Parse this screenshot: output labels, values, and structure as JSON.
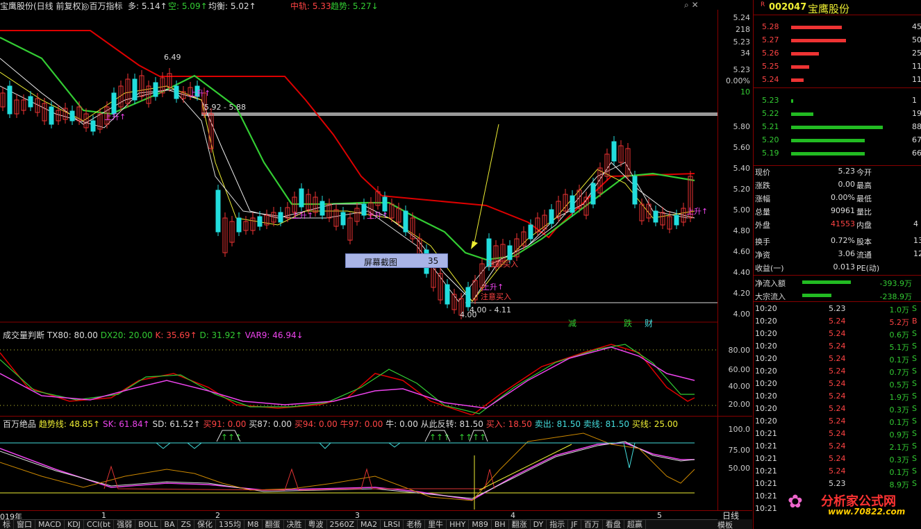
{
  "header": {
    "stock": "宝鹰股份(日线 前复权)",
    "indicator": "百万指标",
    "duo": "多: 5.14↑",
    "kong": "空: 5.09↑",
    "jun": "均衡: 5.02↑",
    "zhonggui": "中轨: 5.33",
    "qushi": "趋势: 5.27↓"
  },
  "main_axis": [
    "5.24",
    "218",
    "5.23",
    "34",
    "5.23",
    "0.00%",
    "10",
    "5.80",
    "5.60",
    "5.40",
    "5.20",
    "5.00",
    "4.80",
    "4.60",
    "4.40",
    "4.20",
    "4.00"
  ],
  "annotations": {
    "high": "6.49",
    "gap": "5.92 - 5.88",
    "low": "4.00 - 4.11",
    "low2": "4.00",
    "buy": "注意买入",
    "up1": "上升↑",
    "up2": "上升↑",
    "up3": "上升↑",
    "up4": "上升↑",
    "up5": "上升↑",
    "jian": "减",
    "die": "跌",
    "cai": "财"
  },
  "tooltip": {
    "label": "屏幕截图",
    "value": "35"
  },
  "vol_header": {
    "name": "成交量判断",
    "tx80": "TX80: 80.00",
    "dx20": "DX20: 20.00",
    "k": "K: 35.69↑",
    "d": "D: 31.92↑",
    "var9": "VAR9: 46.94↓"
  },
  "vol_axis": [
    "80.00",
    "60.00",
    "40.00",
    "20.00"
  ],
  "bw_header": {
    "name": "百万绝品",
    "qsx": "趋势线: 48.85↑",
    "sk": "SK: 61.84↑",
    "sd": "SD: 61.52↑",
    "m91": "买91: 0.00",
    "m87": "买87: 0.00",
    "m94": "买94: 0.00",
    "n97": "牛97: 0.00",
    "niu": "牛: 0.00",
    "cc": "从此反转: 81.50",
    "mr": "买入: 18.50",
    "mc": "卖出: 81.50",
    "mx": "卖线: 81.50",
    "mxb": "买线: 25.00"
  },
  "bw_axis": [
    "100.0",
    "75.00",
    "50.00"
  ],
  "date_axis": [
    "019年",
    "1",
    "2",
    "3",
    "4",
    "5"
  ],
  "tabs": [
    "标",
    "窗口",
    "MACD",
    "KDJ",
    "CCI(bt",
    "强弱",
    "BOLL",
    "BA",
    "ZS",
    "保化",
    "135均",
    "M8",
    "翻蛋",
    "决胜",
    "粤波",
    "2560Z",
    "MA2",
    "LRSI",
    "老杨",
    "里牛",
    "HHY",
    "M89",
    "BH",
    "翻涨",
    "DY",
    "指示",
    "JF",
    "百万",
    "看盘",
    "超赢"
  ],
  "bottom_right": {
    "model": "模板",
    "period": "日线"
  },
  "quote": {
    "code": "002047",
    "name": "宝鹰股份",
    "flag": "R",
    "asks": [
      {
        "p": "5.28",
        "v": "45",
        "w": 0.55
      },
      {
        "p": "5.27",
        "v": "50",
        "w": 0.6
      },
      {
        "p": "5.26",
        "v": "25",
        "w": 0.3
      },
      {
        "p": "5.25",
        "v": "11",
        "w": 0.2
      },
      {
        "p": "5.24",
        "v": "11",
        "w": 0.14
      }
    ],
    "bids": [
      {
        "p": "5.23",
        "v": "1",
        "w": 0.02
      },
      {
        "p": "5.22",
        "v": "19",
        "w": 0.24
      },
      {
        "p": "5.21",
        "v": "88",
        "w": 1.0
      },
      {
        "p": "5.20",
        "v": "67",
        "w": 0.8
      },
      {
        "p": "5.19",
        "v": "66",
        "w": 0.8
      }
    ],
    "stats": [
      [
        "现价",
        "5.23",
        "今开",
        ""
      ],
      [
        "涨跌",
        "0.00",
        "最高",
        ""
      ],
      [
        "涨幅",
        "0.00%",
        "最低",
        ""
      ],
      [
        "总量",
        "90961",
        "量比",
        ""
      ],
      [
        "外盘",
        "41553",
        "内盘",
        "4"
      ],
      [
        "换手",
        "0.72%",
        "股本",
        "13"
      ],
      [
        "净资",
        "3.06",
        "流通",
        "12"
      ],
      [
        "收益(一)",
        "0.013",
        "PE(动)",
        ""
      ]
    ],
    "flows": [
      {
        "label": "净流入额",
        "value": "-393.9万"
      },
      {
        "label": "大宗流入",
        "value": "-238.9万"
      }
    ],
    "ticks": [
      [
        "10:20",
        "5.23",
        "1.0万",
        "S"
      ],
      [
        "10:20",
        "5.24",
        "5.2万",
        "B"
      ],
      [
        "10:20",
        "5.24",
        "0.6万",
        "S"
      ],
      [
        "10:20",
        "5.24",
        "5.1万",
        "S"
      ],
      [
        "10:20",
        "5.24",
        "0.1万",
        "S"
      ],
      [
        "10:20",
        "5.24",
        "0.7万",
        "S"
      ],
      [
        "10:20",
        "5.24",
        "0.5万",
        "S"
      ],
      [
        "10:20",
        "5.24",
        "1.9万",
        "S"
      ],
      [
        "10:20",
        "5.24",
        "0.3万",
        "S"
      ],
      [
        "10:20",
        "5.24",
        "0.1万",
        "S"
      ],
      [
        "10:21",
        "5.24",
        "0.9万",
        "S"
      ],
      [
        "10:21",
        "5.24",
        "2.1万",
        "S"
      ],
      [
        "10:21",
        "5.24",
        "0.3万",
        "S"
      ],
      [
        "10:21",
        "5.24",
        "0.1万",
        "S"
      ],
      [
        "10:21",
        "5.23",
        "8.9万",
        "S"
      ],
      [
        "10:21",
        "",
        "",
        ""
      ],
      [
        "10:21",
        "",
        "",
        ""
      ]
    ]
  },
  "watermark": {
    "text": "分析家公式网",
    "url": "www.70822.com"
  }
}
